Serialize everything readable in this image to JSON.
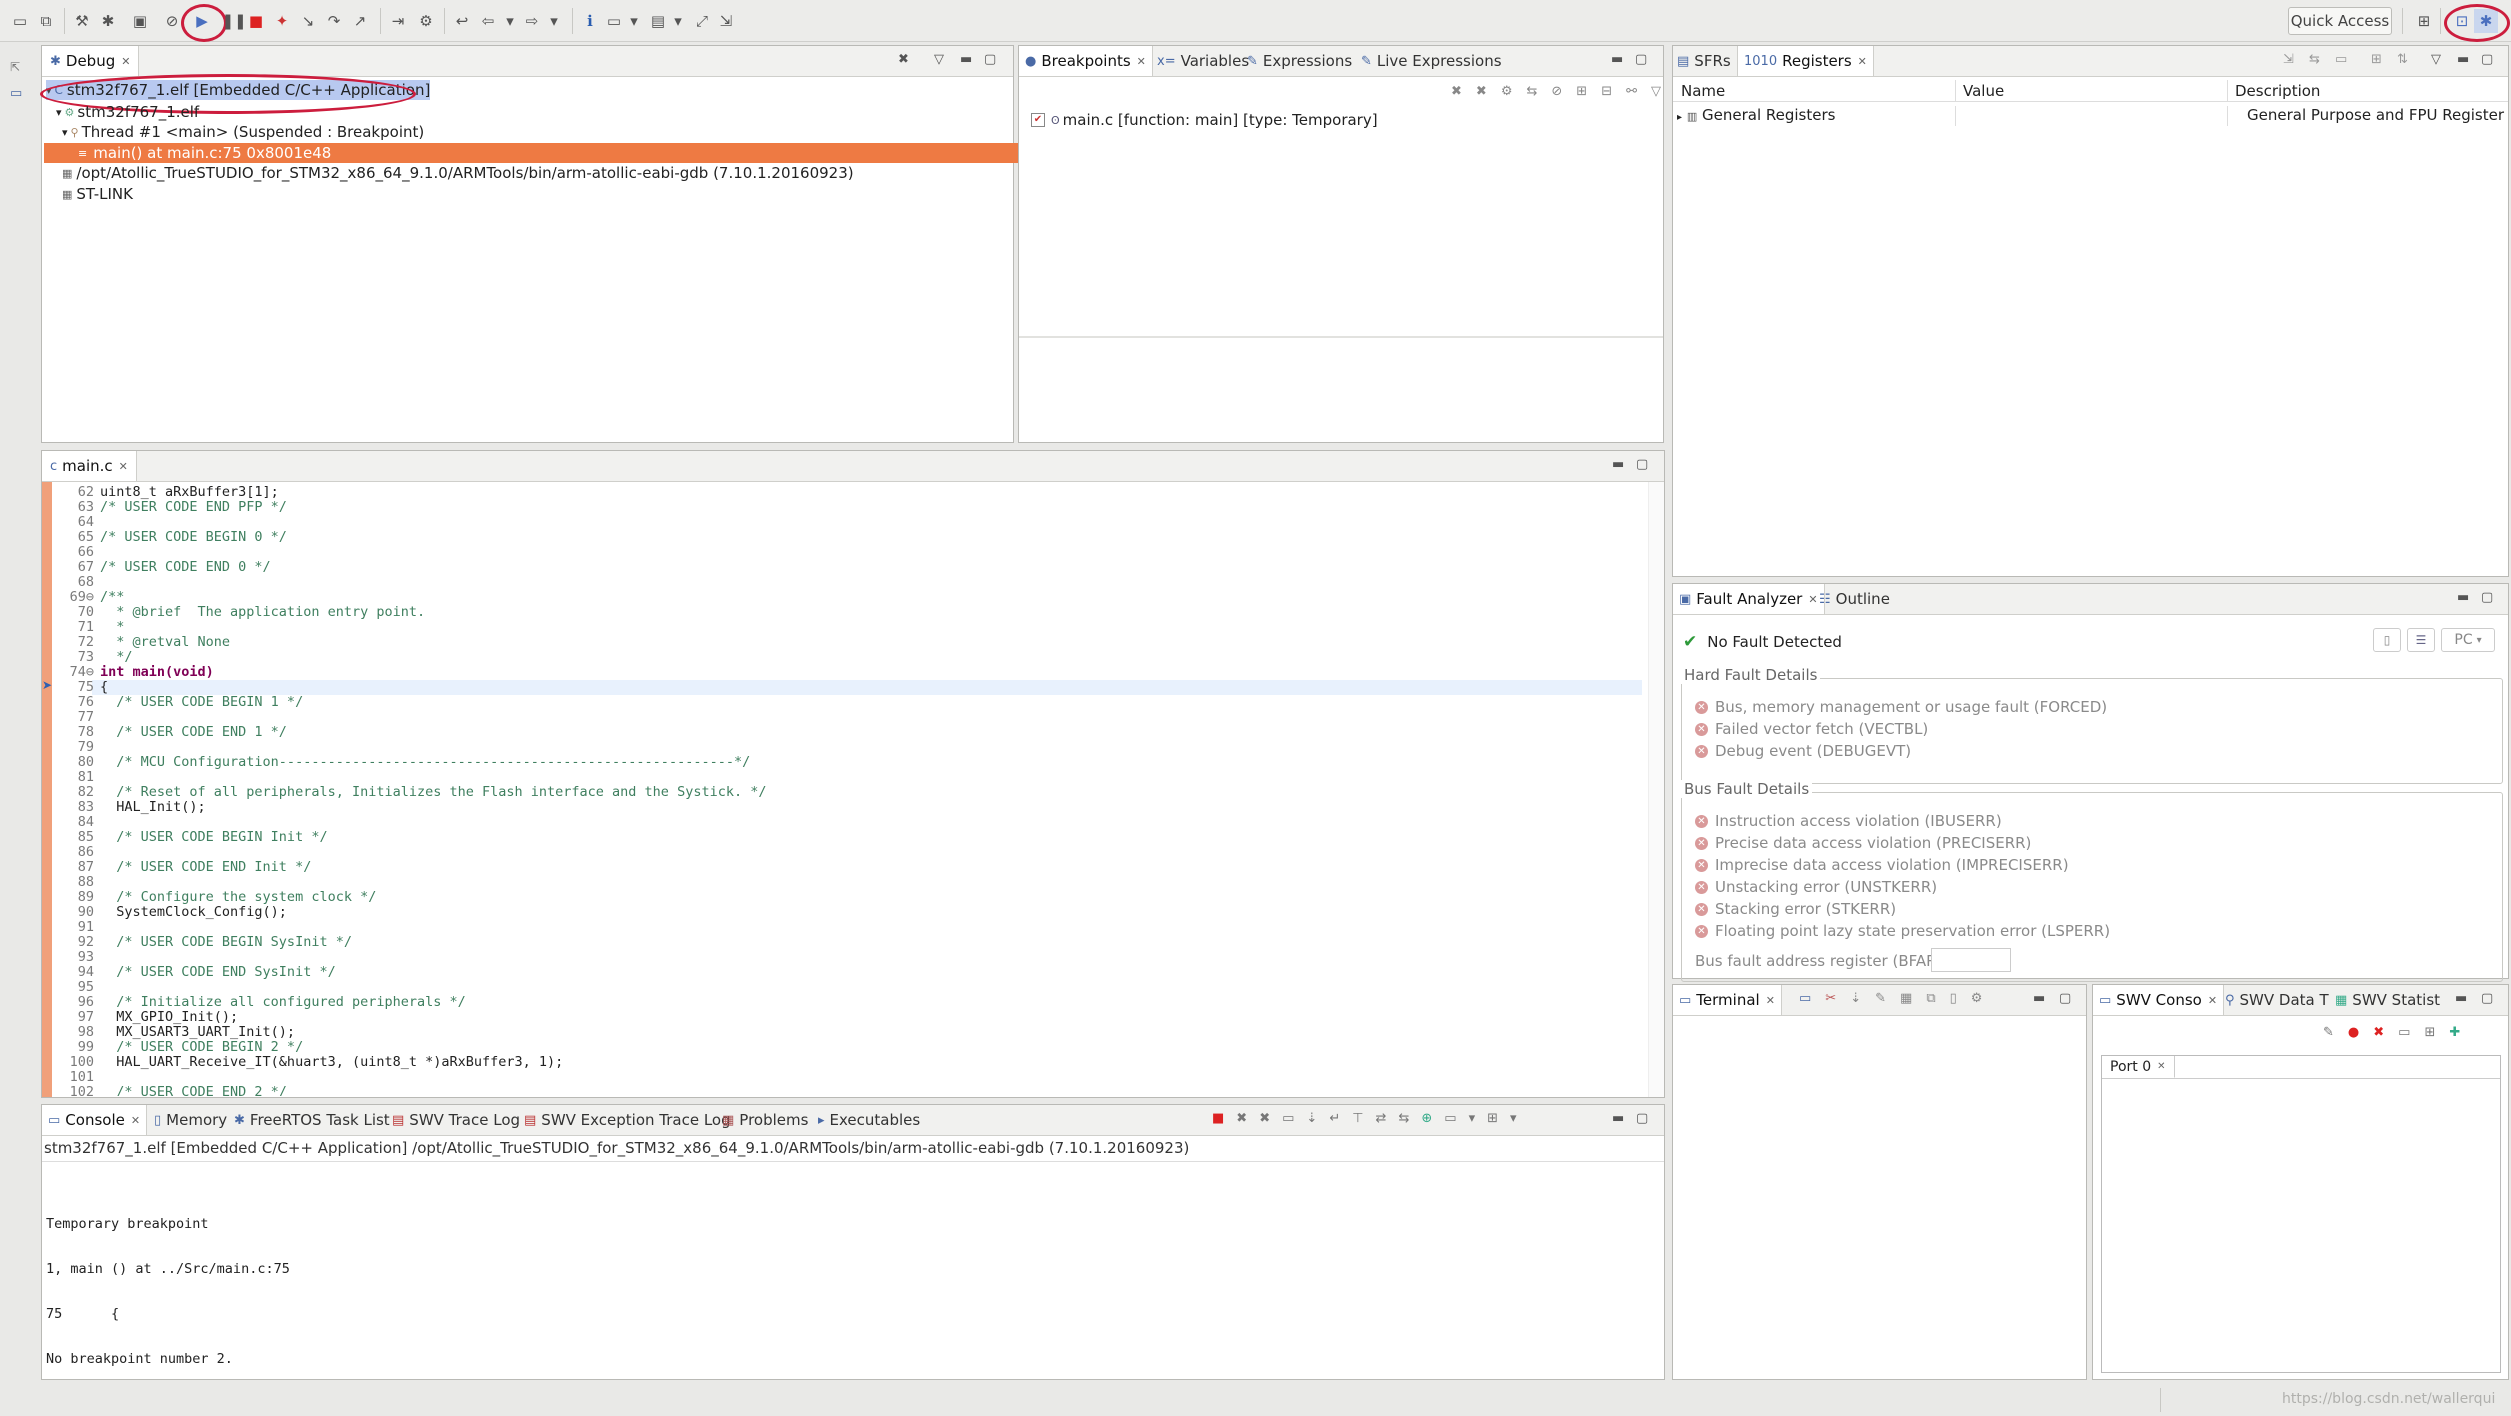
{
  "toolbar": {
    "quick_access_label": "Quick Access"
  },
  "debug_panel": {
    "tab_label": "Debug",
    "tree": [
      "stm32f767_1.elf [Embedded C/C++ Application]",
      "stm32f767_1.elf",
      "Thread #1 <main> (Suspended : Breakpoint)",
      "main() at main.c:75 0x8001e48",
      "/opt/Atollic_TrueSTUDIO_for_STM32_x86_64_9.1.0/ARMTools/bin/arm-atollic-eabi-gdb (7.10.1.20160923)",
      "ST-LINK"
    ]
  },
  "bp_panel": {
    "tabs": [
      "Breakpoints",
      "Variables",
      "Expressions",
      "Live Expressions"
    ],
    "entry": "main.c [function: main] [type: Temporary]"
  },
  "reg_panel": {
    "tabs": [
      "SFRs",
      "Registers"
    ],
    "columns": [
      "Name",
      "Value",
      "Description"
    ],
    "row_name": "General Registers",
    "row_desc": "General Purpose and FPU Register Grc"
  },
  "editor": {
    "tab_label": "main.c",
    "lines": [
      {
        "n": "62",
        "t": "uint8_t aRxBuffer3[1];"
      },
      {
        "n": "63",
        "t": "/* USER CODE END PFP */"
      },
      {
        "n": "64",
        "t": ""
      },
      {
        "n": "65",
        "t": "/* USER CODE BEGIN 0 */"
      },
      {
        "n": "66",
        "t": ""
      },
      {
        "n": "67",
        "t": "/* USER CODE END 0 */"
      },
      {
        "n": "68",
        "t": ""
      },
      {
        "n": "69⊖",
        "t": "/**"
      },
      {
        "n": "70",
        "t": "  * @brief  The application entry point."
      },
      {
        "n": "71",
        "t": "  *"
      },
      {
        "n": "72",
        "t": "  * @retval None"
      },
      {
        "n": "73",
        "t": "  */"
      },
      {
        "n": "74⊖",
        "t": "int main(void)"
      },
      {
        "n": "75",
        "t": "{"
      },
      {
        "n": "76",
        "t": "  /* USER CODE BEGIN 1 */"
      },
      {
        "n": "77",
        "t": ""
      },
      {
        "n": "78",
        "t": "  /* USER CODE END 1 */"
      },
      {
        "n": "79",
        "t": ""
      },
      {
        "n": "80",
        "t": "  /* MCU Configuration--------------------------------------------------------*/"
      },
      {
        "n": "81",
        "t": ""
      },
      {
        "n": "82",
        "t": "  /* Reset of all peripherals, Initializes the Flash interface and the Systick. */"
      },
      {
        "n": "83",
        "t": "  HAL_Init();"
      },
      {
        "n": "84",
        "t": ""
      },
      {
        "n": "85",
        "t": "  /* USER CODE BEGIN Init */"
      },
      {
        "n": "86",
        "t": ""
      },
      {
        "n": "87",
        "t": "  /* USER CODE END Init */"
      },
      {
        "n": "88",
        "t": ""
      },
      {
        "n": "89",
        "t": "  /* Configure the system clock */"
      },
      {
        "n": "90",
        "t": "  SystemClock_Config();"
      },
      {
        "n": "91",
        "t": ""
      },
      {
        "n": "92",
        "t": "  /* USER CODE BEGIN SysInit */"
      },
      {
        "n": "93",
        "t": ""
      },
      {
        "n": "94",
        "t": "  /* USER CODE END SysInit */"
      },
      {
        "n": "95",
        "t": ""
      },
      {
        "n": "96",
        "t": "  /* Initialize all configured peripherals */"
      },
      {
        "n": "97",
        "t": "  MX_GPIO_Init();"
      },
      {
        "n": "98",
        "t": "  MX_USART3_UART_Init();"
      },
      {
        "n": "99",
        "t": "  /* USER CODE BEGIN 2 */"
      },
      {
        "n": "100",
        "t": "  HAL_UART_Receive_IT(&huart3, (uint8_t *)aRxBuffer3, 1);"
      },
      {
        "n": "101",
        "t": ""
      },
      {
        "n": "102",
        "t": "  /* USER CODE END 2 */"
      }
    ]
  },
  "fault_panel": {
    "tabs": [
      "Fault Analyzer",
      "Outline"
    ],
    "status": "No Fault Detected",
    "pc_label": "PC",
    "hard_title": "Hard Fault Details",
    "hard_items": [
      "Bus, memory management or usage fault (FORCED)",
      "Failed vector fetch (VECTBL)",
      "Debug event (DEBUGEVT)"
    ],
    "bus_title": "Bus Fault Details",
    "bus_items": [
      "Instruction access violation (IBUSERR)",
      "Precise data access violation (PRECISERR)",
      "Imprecise data access violation (IMPRECISERR)",
      "Unstacking error (UNSTKERR)",
      "Stacking error (STKERR)",
      "Floating point lazy state preservation error (LSPERR)"
    ],
    "bfar_label": "Bus fault address register (BFAR):"
  },
  "console_panel": {
    "tabs": [
      "Console",
      "Memory",
      "FreeRTOS Task List",
      "SWV Trace Log",
      "SWV Exception Trace Log",
      "Problems",
      "Executables"
    ],
    "header": "stm32f767_1.elf [Embedded C/C++ Application] /opt/Atollic_TrueSTUDIO_for_STM32_x86_64_9.1.0/ARMTools/bin/arm-atollic-eabi-gdb (7.10.1.20160923)",
    "lines": [
      "Temporary breakpoint",
      "1, main () at ../Src/main.c:75",
      "75      {",
      "No breakpoint number 2."
    ]
  },
  "terminal_panel": {
    "tab_label": "Terminal"
  },
  "swv_panel": {
    "tabs": [
      "SWV Conso",
      "SWV Data T",
      "SWV Statist"
    ],
    "port_tab": "Port 0"
  },
  "watermark": "https://blog.csdn.net/wallerqui"
}
